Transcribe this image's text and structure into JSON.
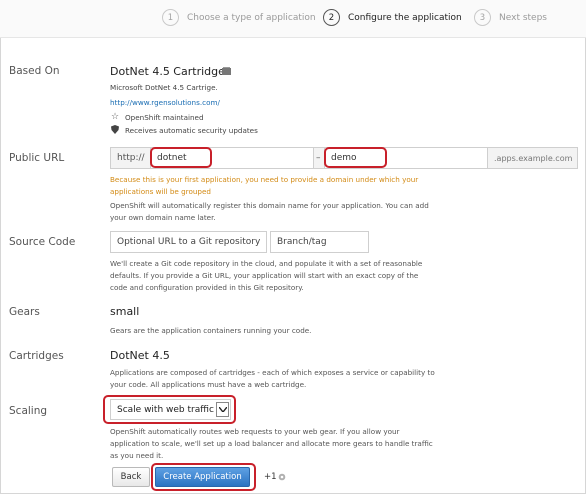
{
  "steps": [
    {
      "num": "1",
      "label": "Choose a type of application"
    },
    {
      "num": "2",
      "label": "Configure the application"
    },
    {
      "num": "3",
      "label": "Next steps"
    }
  ],
  "based_on": {
    "label": "Based On",
    "title": "DotNet 4.5 Cartridge",
    "description": "Microsoft DotNet 4.5 Cartrige.",
    "url": "http://www.rgensolutions.com/",
    "maintained": "OpenShift maintained",
    "security": "Receives automatic security updates"
  },
  "public_url": {
    "label": "Public URL",
    "prefix": "http://",
    "app_name": "dotnet",
    "separator": "–",
    "namespace": "demo",
    "suffix": ".apps.example.com",
    "warning_line1": "Because this is your first application, you need to provide a domain under which your",
    "warning_line2": "applications will be grouped",
    "help_line1": "OpenShift will automatically register this domain name for your application. You can add",
    "help_line2": "your own domain name later."
  },
  "source_code": {
    "label": "Source Code",
    "repo_placeholder": "Optional URL to a Git repository",
    "branch_placeholder": "Branch/tag",
    "help_line1": "We'll create a Git code repository in the cloud, and populate it with a set of reasonable",
    "help_line2": "defaults. If you provide a Git URL, your application will start with an exact copy of the",
    "help_line3": "code and configuration provided in this Git repository."
  },
  "gears": {
    "label": "Gears",
    "value": "small",
    "help": "Gears are the application containers running your code."
  },
  "cartridges": {
    "label": "Cartridges",
    "value": "DotNet 4.5",
    "help_line1": "Applications are composed of cartridges - each of which exposes a service or capability to",
    "help_line2": "your code. All applications must have a web cartridge."
  },
  "scaling": {
    "label": "Scaling",
    "selected": "Scale with web traffic",
    "help_line1": "OpenShift automatically routes web requests to your web gear. If you allow your",
    "help_line2": "application to scale, we'll set up a load balancer and allocate more gears to handle traffic",
    "help_line3": "as you need it."
  },
  "actions": {
    "back": "Back",
    "create": "Create Application",
    "gear_cost": "+1"
  }
}
